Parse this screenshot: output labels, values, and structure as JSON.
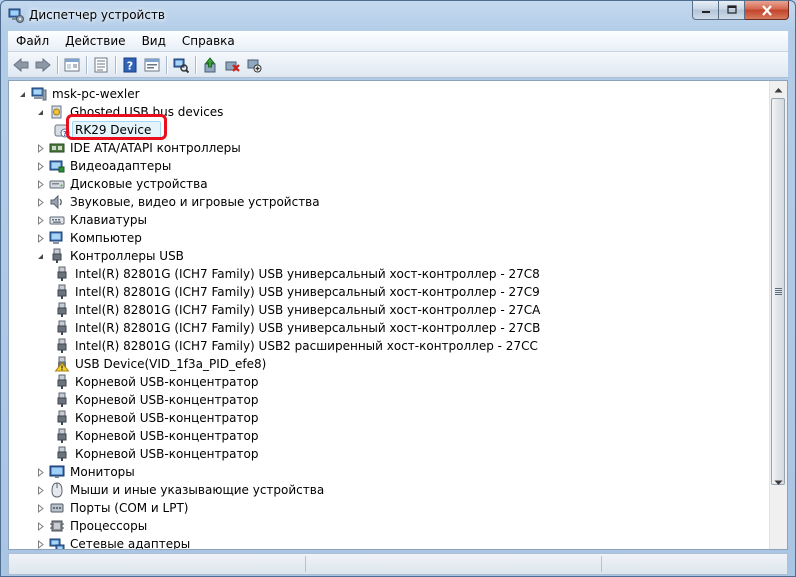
{
  "window": {
    "title": "Диспетчер устройств",
    "buttons": [
      "minimize-icon",
      "maximize-icon",
      "close-icon"
    ]
  },
  "menu": [
    "Файл",
    "Действие",
    "Вид",
    "Справка"
  ],
  "toolbar": [
    "back-icon",
    "forward-icon",
    "sep",
    "show-hide-tree-icon",
    "sep",
    "properties-icon",
    "sep",
    "help-icon",
    "properties-sheet-icon",
    "sep",
    "scan-hardware-icon",
    "sep",
    "update-driver-icon",
    "uninstall-icon",
    "disable-icon"
  ],
  "tree": {
    "root": "msk-pc-wexler",
    "items": [
      {
        "label": "Ghosted USB bus devices",
        "level": 1,
        "expanded": true,
        "icon": "usb-device-icon"
      },
      {
        "label": "RK29 Device",
        "level": 2,
        "icon": "unknown-device-icon",
        "selected": true
      },
      {
        "label": "IDE ATA/ATAPI контроллеры",
        "level": 1,
        "icon": "ide-controller-icon"
      },
      {
        "label": "Видеоадаптеры",
        "level": 1,
        "icon": "display-adapter-icon"
      },
      {
        "label": "Дисковые устройства",
        "level": 1,
        "icon": "disk-drive-icon"
      },
      {
        "label": "Звуковые, видео и игровые устройства",
        "level": 1,
        "icon": "speaker-icon"
      },
      {
        "label": "Клавиатуры",
        "level": 1,
        "icon": "keyboard-icon"
      },
      {
        "label": "Компьютер",
        "level": 1,
        "icon": "computer-icon"
      },
      {
        "label": "Контроллеры USB",
        "level": 1,
        "expanded": true,
        "icon": "usb-plug-icon"
      },
      {
        "label": "Intel(R) 82801G (ICH7 Family) USB универсальный хост-контроллер  - 27C8",
        "level": 2,
        "icon": "usb-plug-icon"
      },
      {
        "label": "Intel(R) 82801G (ICH7 Family) USB универсальный хост-контроллер  - 27C9",
        "level": 2,
        "icon": "usb-plug-icon"
      },
      {
        "label": "Intel(R) 82801G (ICH7 Family) USB универсальный хост-контроллер - 27CA",
        "level": 2,
        "icon": "usb-plug-icon"
      },
      {
        "label": "Intel(R) 82801G (ICH7 Family) USB универсальный хост-контроллер - 27CB",
        "level": 2,
        "icon": "usb-plug-icon"
      },
      {
        "label": "Intel(R) 82801G (ICH7 Family) USB2 расширенный хост-контроллер - 27CC",
        "level": 2,
        "icon": "usb-plug-icon"
      },
      {
        "label": "USB Device(VID_1f3a_PID_efe8)",
        "level": 2,
        "icon": "warning-device-icon"
      },
      {
        "label": "Корневой USB-концентратор",
        "level": 2,
        "icon": "usb-plug-icon"
      },
      {
        "label": "Корневой USB-концентратор",
        "level": 2,
        "icon": "usb-plug-icon"
      },
      {
        "label": "Корневой USB-концентратор",
        "level": 2,
        "icon": "usb-plug-icon"
      },
      {
        "label": "Корневой USB-концентратор",
        "level": 2,
        "icon": "usb-plug-icon"
      },
      {
        "label": "Корневой USB-концентратор",
        "level": 2,
        "icon": "usb-plug-icon"
      },
      {
        "label": "Мониторы",
        "level": 1,
        "icon": "monitor-icon"
      },
      {
        "label": "Мыши и иные указывающие устройства",
        "level": 1,
        "icon": "mouse-icon"
      },
      {
        "label": "Порты (COM и LPT)",
        "level": 1,
        "icon": "port-icon"
      },
      {
        "label": "Процессоры",
        "level": 1,
        "icon": "processor-icon"
      },
      {
        "label": "Сетевые адаптеры",
        "level": 1,
        "icon": "network-adapter-icon"
      }
    ]
  }
}
